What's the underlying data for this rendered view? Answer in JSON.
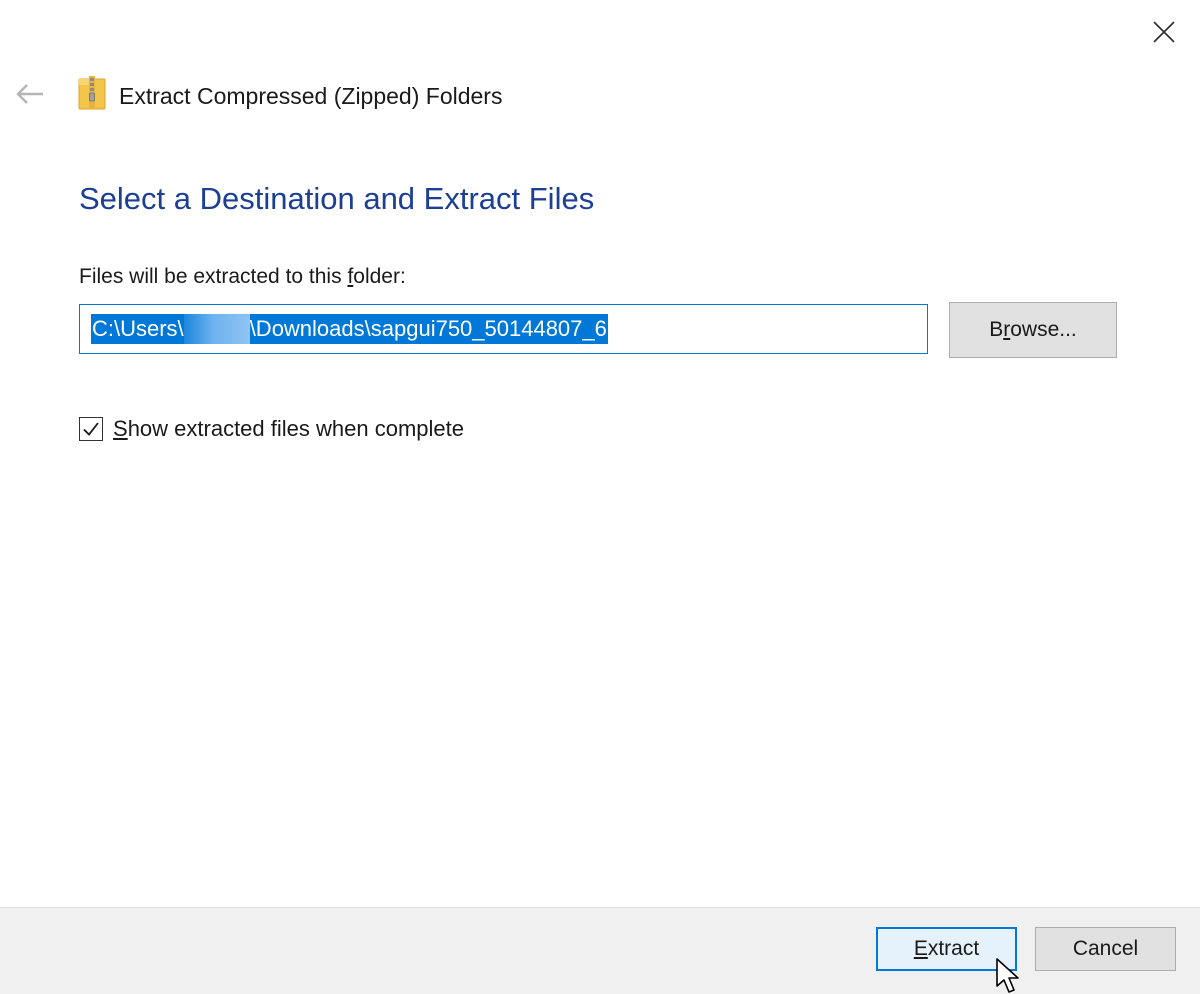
{
  "window": {
    "title": "Extract Compressed (Zipped) Folders",
    "icons": {
      "back": "arrow-left-icon",
      "close": "close-icon",
      "app": "zipped-folder-icon"
    }
  },
  "main": {
    "heading": "Select a Destination and Extract Files",
    "folder_label_pre": "Files will be extracted to this ",
    "folder_label_accel": "f",
    "folder_label_post": "older:",
    "path": {
      "prefix": "C:\\Users\\",
      "suffix": "\\Downloads\\sapgui750_50144807_6",
      "selected": true
    },
    "browse": {
      "pre": "B",
      "accel": "r",
      "post": "owse..."
    },
    "show_files": {
      "checked": true,
      "pre": "",
      "accel": "S",
      "post": "how extracted files when complete"
    }
  },
  "footer": {
    "extract": {
      "accel": "E",
      "post": "xtract"
    },
    "cancel_label": "Cancel"
  },
  "colors": {
    "heading": "#1c3f94",
    "accent": "#0078d7",
    "button_bg": "#e1e1e1",
    "footer_bg": "#f0f0f0"
  }
}
